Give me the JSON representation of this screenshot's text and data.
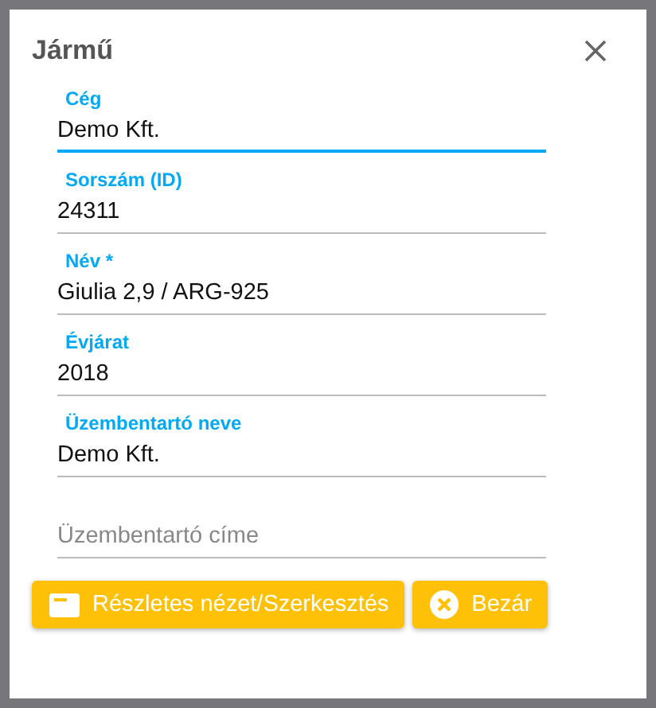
{
  "dialog": {
    "title": "Jármű"
  },
  "fields": [
    {
      "label": "Cég",
      "value": "Demo Kft.",
      "focused": true
    },
    {
      "label": "Sorszám (ID)",
      "value": "24311",
      "focused": false
    },
    {
      "label": "Név *",
      "value": "Giulia 2,9 / ARG-925",
      "focused": false
    },
    {
      "label": "Évjárat",
      "value": "2018",
      "focused": false
    },
    {
      "label": "Üzembentartó neve",
      "value": "Demo Kft.",
      "focused": false
    },
    {
      "placeholder": "Üzembentartó címe",
      "focused": false
    }
  ],
  "buttons": [
    {
      "label": "Részletes nézet/Szerkesztés",
      "kind": "details"
    },
    {
      "label": "Bezár",
      "kind": "close"
    }
  ]
}
